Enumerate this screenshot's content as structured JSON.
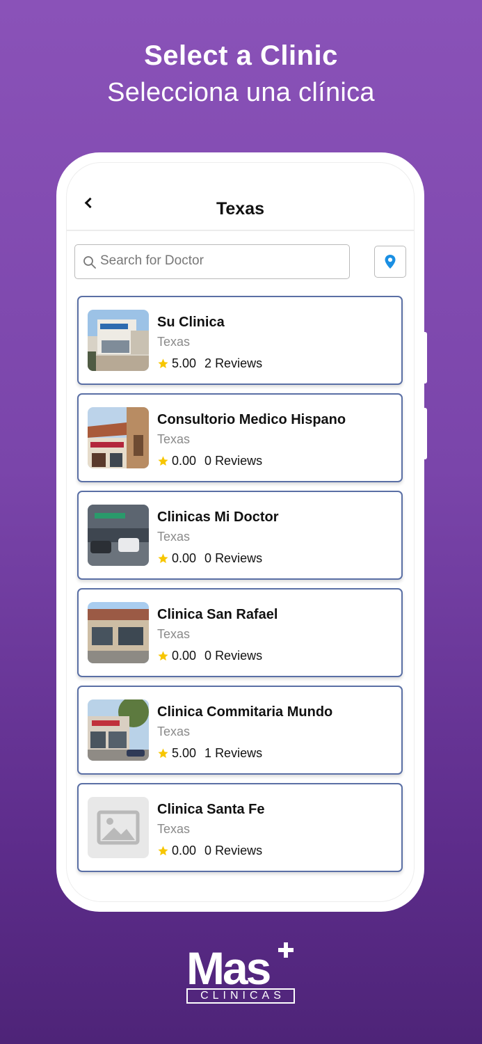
{
  "headline": {
    "english": "Select a  Clinic",
    "spanish": "Selecciona una clínica"
  },
  "appbar": {
    "title": "Texas",
    "back_icon": "chevron-left-icon"
  },
  "search": {
    "placeholder": "Search for Doctor",
    "value": "",
    "icon": "search-icon"
  },
  "map_button": {
    "icon": "map-pin-icon",
    "color": "#1a8fe3"
  },
  "colors": {
    "card_border": "#5a6fa5",
    "star": "#f7c600",
    "background_top": "#8a52b8",
    "background_bottom": "#4e2478"
  },
  "clinics": [
    {
      "name": "Su Clinica",
      "location": "Texas",
      "rating": "5.00",
      "reviews": "2",
      "reviews_label": "Reviews"
    },
    {
      "name": "Consultorio Medico Hispano",
      "location": "Texas",
      "rating": "0.00",
      "reviews": "0",
      "reviews_label": "Reviews"
    },
    {
      "name": "Clinicas Mi Doctor",
      "location": "Texas",
      "rating": "0.00",
      "reviews": "0",
      "reviews_label": "Reviews"
    },
    {
      "name": "Clinica San Rafael",
      "location": "Texas",
      "rating": "0.00",
      "reviews": "0",
      "reviews_label": "Reviews"
    },
    {
      "name": "Clinica Commitaria Mundo",
      "location": "Texas",
      "rating": "5.00",
      "reviews": "1",
      "reviews_label": "Reviews"
    },
    {
      "name": "Clinica Santa Fe",
      "location": "Texas",
      "rating": "0.00",
      "reviews": "0",
      "reviews_label": "Reviews"
    }
  ],
  "logo": {
    "word": "Mas",
    "subtitle": "CLINICAS"
  }
}
